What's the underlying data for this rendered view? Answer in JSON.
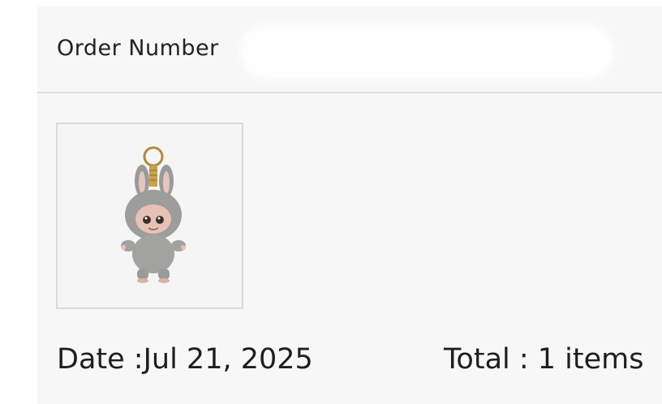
{
  "order": {
    "number_label": "Order Number",
    "number_value": ""
  },
  "product": {
    "image_icon": "plush-keychain-image"
  },
  "footer": {
    "date": "Date :Jul 21, 2025",
    "total": "Total : 1  items"
  },
  "colors": {
    "card_background": "#f7f7f7",
    "divider": "#dedede",
    "text": "#1e1e1e"
  }
}
